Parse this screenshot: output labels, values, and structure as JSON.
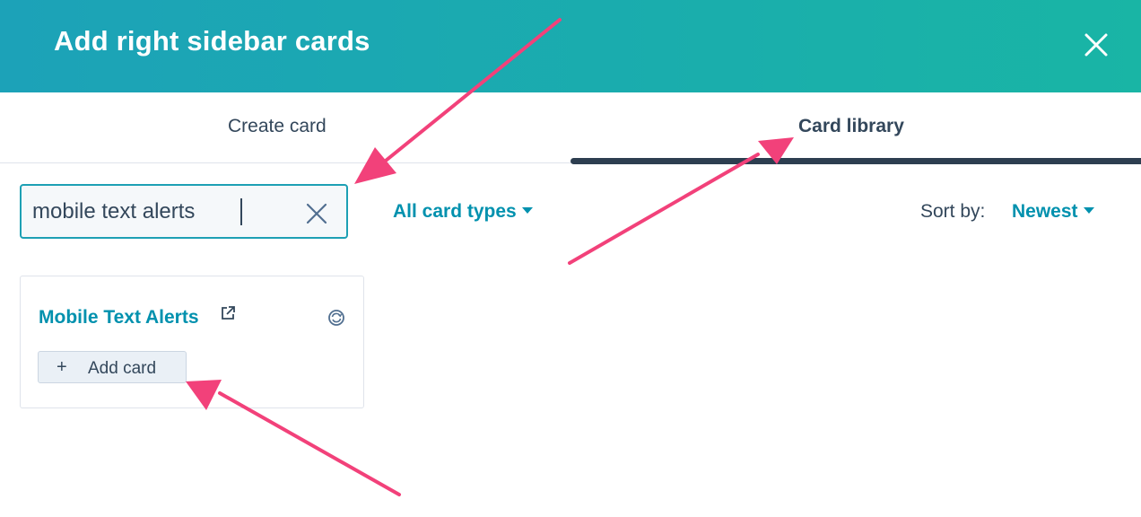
{
  "header": {
    "title": "Add right sidebar cards",
    "close_icon": "close-icon"
  },
  "tabs": [
    {
      "label": "Create card"
    },
    {
      "label": "Card library",
      "active": true
    }
  ],
  "search": {
    "value": "mobile text alerts",
    "clear_icon": "clear-icon"
  },
  "filter": {
    "label": "All card types"
  },
  "sort": {
    "label": "Sort by:",
    "value": "Newest"
  },
  "card": {
    "title": "Mobile Text Alerts",
    "add_label": "Add card",
    "plus": "+"
  },
  "colors": {
    "header_start": "#1ca2b8",
    "header_end": "#19b5a5",
    "accent": "#0091ae",
    "annotation": "#f2417a",
    "tab_underline": "#2d3e50"
  }
}
